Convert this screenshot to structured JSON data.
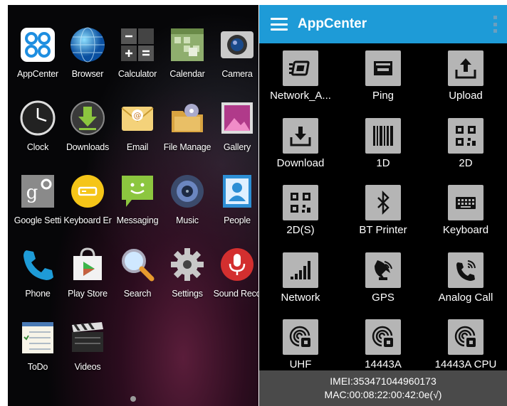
{
  "launcher": {
    "apps": [
      {
        "label": "AppCenter",
        "icon": "appcenter-icon"
      },
      {
        "label": "Browser",
        "icon": "globe-icon"
      },
      {
        "label": "Calculator",
        "icon": "calculator-icon"
      },
      {
        "label": "Calendar",
        "icon": "calendar-icon"
      },
      {
        "label": "Camera",
        "icon": "camera-icon"
      },
      {
        "label": "Clock",
        "icon": "clock-icon"
      },
      {
        "label": "Downloads",
        "icon": "download-icon"
      },
      {
        "label": "Email",
        "icon": "envelope-icon"
      },
      {
        "label": "File Manage",
        "icon": "file-manager-icon"
      },
      {
        "label": "Gallery",
        "icon": "gallery-icon"
      },
      {
        "label": "Google Setti",
        "icon": "google-settings-icon"
      },
      {
        "label": "Keyboard Er",
        "icon": "keyboard-emulator-icon"
      },
      {
        "label": "Messaging",
        "icon": "message-icon"
      },
      {
        "label": "Music",
        "icon": "music-icon"
      },
      {
        "label": "People",
        "icon": "contacts-icon"
      },
      {
        "label": "Phone",
        "icon": "phone-icon"
      },
      {
        "label": "Play Store",
        "icon": "play-store-icon"
      },
      {
        "label": "Search",
        "icon": "search-icon"
      },
      {
        "label": "Settings",
        "icon": "gear-icon"
      },
      {
        "label": "Sound Reco",
        "icon": "microphone-icon"
      },
      {
        "label": "ToDo",
        "icon": "todo-icon"
      },
      {
        "label": "Videos",
        "icon": "clapperboard-icon"
      }
    ]
  },
  "appcenter": {
    "title": "AppCenter",
    "accent": "#1e9bd7",
    "tools": [
      {
        "label": "Network_A...",
        "icon": "network-adapter-icon"
      },
      {
        "label": "Ping",
        "icon": "ping-icon"
      },
      {
        "label": "Upload",
        "icon": "upload-icon"
      },
      {
        "label": "Download",
        "icon": "download-icon"
      },
      {
        "label": "1D",
        "icon": "barcode-icon"
      },
      {
        "label": "2D",
        "icon": "qr-code-icon"
      },
      {
        "label": "2D(S)",
        "icon": "qr-code-icon"
      },
      {
        "label": "BT Printer",
        "icon": "bluetooth-icon"
      },
      {
        "label": "Keyboard",
        "icon": "keyboard-icon"
      },
      {
        "label": "Network",
        "icon": "signal-bars-icon"
      },
      {
        "label": "GPS",
        "icon": "satellite-icon"
      },
      {
        "label": "Analog Call",
        "icon": "phone-ringing-icon"
      },
      {
        "label": "UHF",
        "icon": "rfid-icon"
      },
      {
        "label": "14443A",
        "icon": "rfid-icon"
      },
      {
        "label": "14443A CPU",
        "icon": "rfid-icon"
      }
    ],
    "footer": {
      "imei": "IMEI:353471044960173",
      "mac": "MAC:00:08:22:00:42:0e(√)"
    }
  }
}
